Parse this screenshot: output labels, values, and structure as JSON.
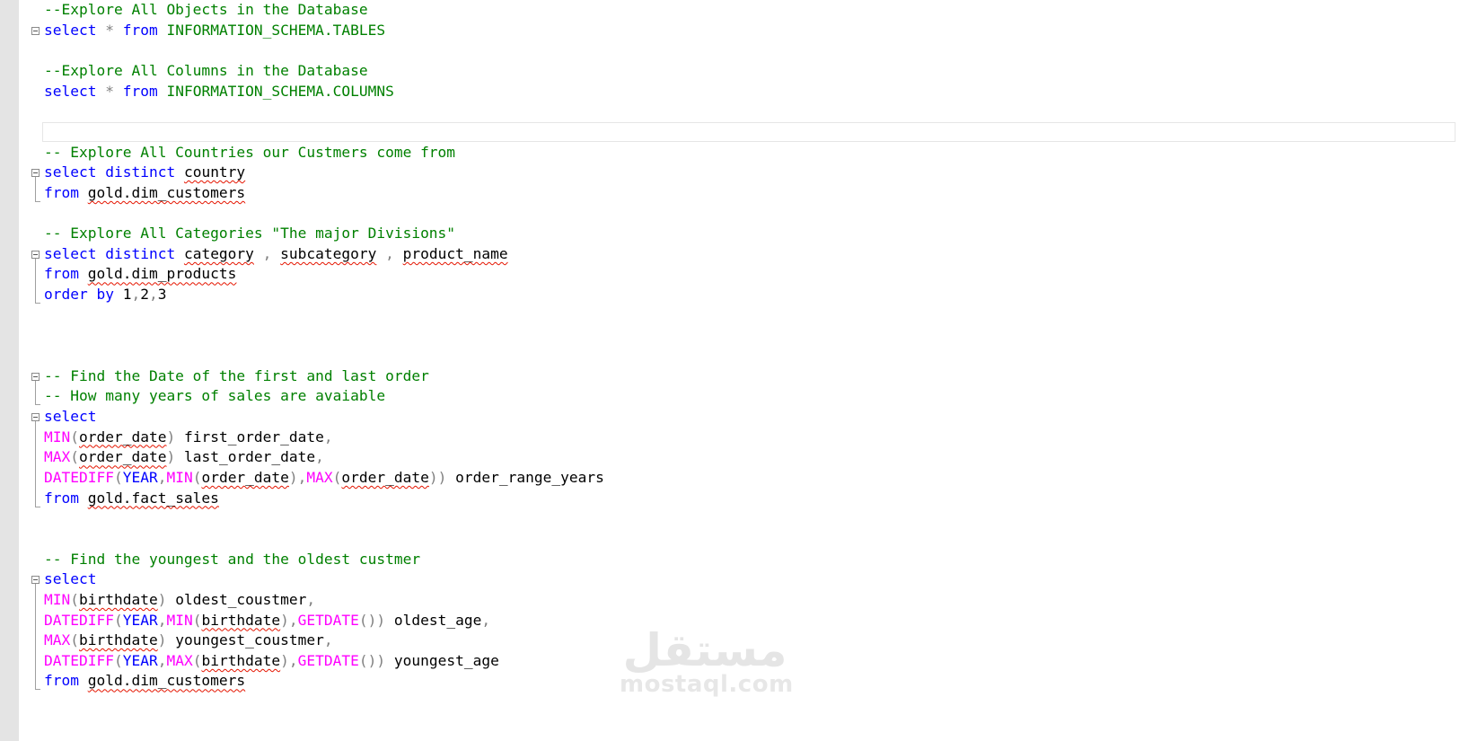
{
  "editor": {
    "lines": [
      [
        {
          "t": "--Explore All Objects in the Database",
          "c": "cm"
        }
      ],
      [
        {
          "t": "select",
          "c": "kw"
        },
        {
          "t": " ",
          "c": "pl"
        },
        {
          "t": "*",
          "c": "gr"
        },
        {
          "t": " ",
          "c": "pl"
        },
        {
          "t": "from",
          "c": "kw"
        },
        {
          "t": " INFORMATION_SCHEMA.TABLES",
          "c": "cm"
        }
      ],
      [],
      [
        {
          "t": "--Explore All Columns in the Database",
          "c": "cm"
        }
      ],
      [
        {
          "t": "select",
          "c": "kw"
        },
        {
          "t": " ",
          "c": "pl"
        },
        {
          "t": "*",
          "c": "gr"
        },
        {
          "t": " ",
          "c": "pl"
        },
        {
          "t": "from",
          "c": "kw"
        },
        {
          "t": " INFORMATION_SCHEMA.COLUMNS",
          "c": "cm"
        }
      ],
      [],
      [],
      [
        {
          "t": "-- Explore All Countries our Custmers come from",
          "c": "cm"
        }
      ],
      [
        {
          "t": "select",
          "c": "kw"
        },
        {
          "t": " ",
          "c": "pl"
        },
        {
          "t": "distinct",
          "c": "kw"
        },
        {
          "t": " ",
          "c": "pl"
        },
        {
          "t": "country",
          "c": "pl",
          "sq": true
        }
      ],
      [
        {
          "t": "from",
          "c": "kw"
        },
        {
          "t": " ",
          "c": "pl"
        },
        {
          "t": "gold.dim_customers",
          "c": "pl",
          "sq": true
        }
      ],
      [],
      [
        {
          "t": "-- Explore All Categories \"The major Divisions\"",
          "c": "cm"
        }
      ],
      [
        {
          "t": "select",
          "c": "kw"
        },
        {
          "t": " ",
          "c": "pl"
        },
        {
          "t": "distinct",
          "c": "kw"
        },
        {
          "t": " ",
          "c": "pl"
        },
        {
          "t": "category",
          "c": "pl",
          "sq": true
        },
        {
          "t": " ",
          "c": "pl"
        },
        {
          "t": ",",
          "c": "gr"
        },
        {
          "t": " ",
          "c": "pl"
        },
        {
          "t": "subcategory",
          "c": "pl",
          "sq": true
        },
        {
          "t": " ",
          "c": "pl"
        },
        {
          "t": ",",
          "c": "gr"
        },
        {
          "t": " ",
          "c": "pl"
        },
        {
          "t": "product_name",
          "c": "pl",
          "sq": true
        }
      ],
      [
        {
          "t": "from",
          "c": "kw"
        },
        {
          "t": " ",
          "c": "pl"
        },
        {
          "t": "gold.dim_products",
          "c": "pl",
          "sq": true
        }
      ],
      [
        {
          "t": "order",
          "c": "kw"
        },
        {
          "t": " ",
          "c": "pl"
        },
        {
          "t": "by",
          "c": "kw"
        },
        {
          "t": " 1",
          "c": "pl"
        },
        {
          "t": ",",
          "c": "gr"
        },
        {
          "t": "2",
          "c": "pl"
        },
        {
          "t": ",",
          "c": "gr"
        },
        {
          "t": "3",
          "c": "pl"
        }
      ],
      [],
      [],
      [],
      [
        {
          "t": "-- Find the Date of the first and last order",
          "c": "cm"
        }
      ],
      [
        {
          "t": "-- How many years of sales are avaiable",
          "c": "cm"
        }
      ],
      [
        {
          "t": "select",
          "c": "kw"
        }
      ],
      [
        {
          "t": "MIN",
          "c": "fn"
        },
        {
          "t": "(",
          "c": "gr"
        },
        {
          "t": "order_date",
          "c": "pl",
          "sq": true
        },
        {
          "t": ")",
          "c": "gr"
        },
        {
          "t": " first_order_date",
          "c": "pl"
        },
        {
          "t": ",",
          "c": "gr"
        }
      ],
      [
        {
          "t": "MAX",
          "c": "fn"
        },
        {
          "t": "(",
          "c": "gr"
        },
        {
          "t": "order_date",
          "c": "pl",
          "sq": true
        },
        {
          "t": ")",
          "c": "gr"
        },
        {
          "t": " last_order_date",
          "c": "pl"
        },
        {
          "t": ",",
          "c": "gr"
        }
      ],
      [
        {
          "t": "DATEDIFF",
          "c": "fn"
        },
        {
          "t": "(",
          "c": "gr"
        },
        {
          "t": "YEAR",
          "c": "kw"
        },
        {
          "t": ",",
          "c": "gr"
        },
        {
          "t": "MIN",
          "c": "fn"
        },
        {
          "t": "(",
          "c": "gr"
        },
        {
          "t": "order_date",
          "c": "pl",
          "sq": true
        },
        {
          "t": ")",
          "c": "gr"
        },
        {
          "t": ",",
          "c": "gr"
        },
        {
          "t": "MAX",
          "c": "fn"
        },
        {
          "t": "(",
          "c": "gr"
        },
        {
          "t": "order_date",
          "c": "pl",
          "sq": true
        },
        {
          "t": "))",
          "c": "gr"
        },
        {
          "t": " order_range_years",
          "c": "pl"
        }
      ],
      [
        {
          "t": "from",
          "c": "kw"
        },
        {
          "t": " ",
          "c": "pl"
        },
        {
          "t": "gold.fact_sales",
          "c": "pl",
          "sq": true
        }
      ],
      [],
      [],
      [
        {
          "t": "-- Find the youngest and the oldest custmer",
          "c": "cm"
        }
      ],
      [
        {
          "t": "select",
          "c": "kw"
        }
      ],
      [
        {
          "t": "MIN",
          "c": "fn"
        },
        {
          "t": "(",
          "c": "gr"
        },
        {
          "t": "birthdate",
          "c": "pl",
          "sq": true
        },
        {
          "t": ")",
          "c": "gr"
        },
        {
          "t": " oldest_coustmer",
          "c": "pl"
        },
        {
          "t": ",",
          "c": "gr"
        }
      ],
      [
        {
          "t": "DATEDIFF",
          "c": "fn"
        },
        {
          "t": "(",
          "c": "gr"
        },
        {
          "t": "YEAR",
          "c": "kw"
        },
        {
          "t": ",",
          "c": "gr"
        },
        {
          "t": "MIN",
          "c": "fn"
        },
        {
          "t": "(",
          "c": "gr"
        },
        {
          "t": "birthdate",
          "c": "pl",
          "sq": true
        },
        {
          "t": ")",
          "c": "gr"
        },
        {
          "t": ",",
          "c": "gr"
        },
        {
          "t": "GETDATE",
          "c": "fn"
        },
        {
          "t": "())",
          "c": "gr"
        },
        {
          "t": " oldest_age",
          "c": "pl"
        },
        {
          "t": ",",
          "c": "gr"
        }
      ],
      [
        {
          "t": "MAX",
          "c": "fn"
        },
        {
          "t": "(",
          "c": "gr"
        },
        {
          "t": "birthdate",
          "c": "pl",
          "sq": true
        },
        {
          "t": ")",
          "c": "gr"
        },
        {
          "t": " youngest_coustmer",
          "c": "pl"
        },
        {
          "t": ",",
          "c": "gr"
        }
      ],
      [
        {
          "t": "DATEDIFF",
          "c": "fn"
        },
        {
          "t": "(",
          "c": "gr"
        },
        {
          "t": "YEAR",
          "c": "kw"
        },
        {
          "t": ",",
          "c": "gr"
        },
        {
          "t": "MAX",
          "c": "fn"
        },
        {
          "t": "(",
          "c": "gr"
        },
        {
          "t": "birthdate",
          "c": "pl",
          "sq": true
        },
        {
          "t": ")",
          "c": "gr"
        },
        {
          "t": ",",
          "c": "gr"
        },
        {
          "t": "GETDATE",
          "c": "fn"
        },
        {
          "t": "())",
          "c": "gr"
        },
        {
          "t": " youngest_age",
          "c": "pl"
        }
      ],
      [
        {
          "t": "from",
          "c": "kw"
        },
        {
          "t": " ",
          "c": "pl"
        },
        {
          "t": "gold.dim_customers",
          "c": "pl",
          "sq": true
        }
      ]
    ],
    "fold_blocks": [
      [
        1,
        1
      ],
      [
        8,
        9
      ],
      [
        12,
        14
      ],
      [
        18,
        19
      ],
      [
        20,
        24
      ],
      [
        28,
        33
      ]
    ]
  },
  "colors": {
    "keyword": "#0000ff",
    "comment": "#008000",
    "function": "#ff00ff",
    "operator": "#808080",
    "squiggle": "#e51400"
  },
  "watermark": {
    "arabic_logo": "مستقل",
    "text": "mostaql.com"
  }
}
